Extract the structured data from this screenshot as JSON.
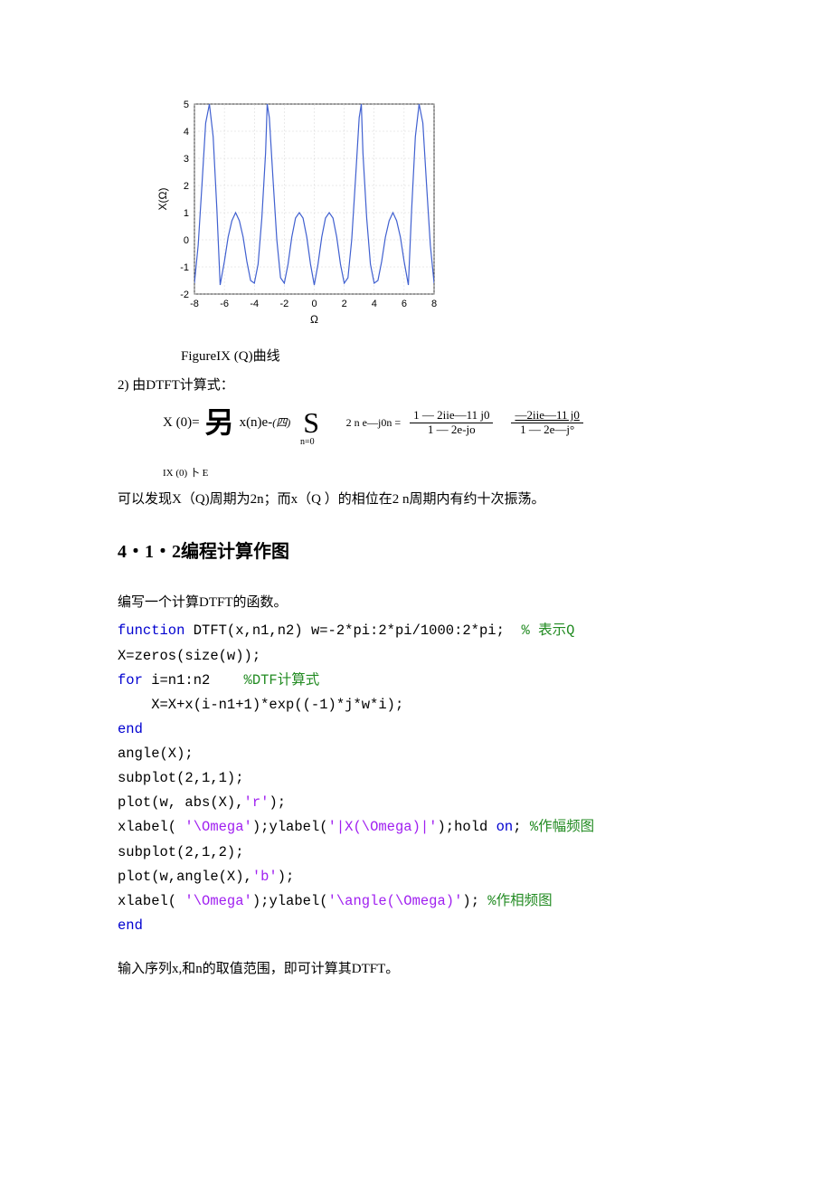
{
  "chart_data": {
    "type": "line",
    "title": "",
    "xlabel": "Ω",
    "ylabel": "X(Ω)",
    "xlim": [
      -8,
      8
    ],
    "ylim": [
      -2,
      5
    ],
    "xticks": [
      -8,
      -6,
      -4,
      -2,
      0,
      2,
      4,
      6,
      8
    ],
    "yticks": [
      -2,
      -1,
      0,
      1,
      2,
      3,
      4,
      5
    ],
    "x": [
      -8.0,
      -7.75,
      -7.5,
      -7.25,
      -7.0,
      -6.75,
      -6.5,
      -6.283,
      -6.0,
      -5.75,
      -5.5,
      -5.25,
      -5.0,
      -4.75,
      -4.5,
      -4.25,
      -4.0,
      -3.75,
      -3.5,
      -3.25,
      -3.142,
      -3.0,
      -2.75,
      -2.5,
      -2.25,
      -2.0,
      -1.75,
      -1.5,
      -1.25,
      -1.0,
      -0.75,
      -0.5,
      -0.25,
      0.0,
      0.25,
      0.5,
      0.75,
      1.0,
      1.25,
      1.5,
      1.75,
      2.0,
      2.25,
      2.5,
      2.75,
      3.0,
      3.142,
      3.25,
      3.5,
      3.75,
      4.0,
      4.25,
      4.5,
      4.75,
      5.0,
      5.25,
      5.5,
      5.75,
      6.0,
      6.283,
      6.5,
      6.75,
      7.0,
      7.25,
      7.5,
      7.75,
      8.0
    ],
    "values": [
      -1.6,
      -0.2,
      2.0,
      4.3,
      5.0,
      3.8,
      1.1,
      -1.667,
      -0.8,
      0.1,
      0.7,
      1.0,
      0.7,
      0.1,
      -0.8,
      -1.5,
      -1.6,
      -0.9,
      0.8,
      3.2,
      5.0,
      4.5,
      2.2,
      0.0,
      -1.4,
      -1.6,
      -0.9,
      0.1,
      0.8,
      1.0,
      0.8,
      0.1,
      -0.9,
      -1.667,
      -0.9,
      0.1,
      0.8,
      1.0,
      0.8,
      0.1,
      -0.9,
      -1.6,
      -1.4,
      0.0,
      2.2,
      4.5,
      5.0,
      3.2,
      0.8,
      -0.9,
      -1.6,
      -1.5,
      -0.8,
      0.1,
      0.7,
      1.0,
      0.7,
      0.1,
      -0.8,
      -1.667,
      1.1,
      3.8,
      5.0,
      4.3,
      2.0,
      -0.2,
      -1.6
    ]
  },
  "fig_caption": "FigureIX (Q)曲线",
  "calc_label": "2) 由DTFT计算式：",
  "eq": {
    "lhs": "X (0)=",
    "cn": "另",
    "term1": "x(n)e-",
    "term1_it": "(四)",
    "S": "S",
    "neq": "n=0",
    "sub2": "2 n e—j0n =",
    "f1num": "1 — 2iie—11 j0",
    "f1den": "1 — 2e-jo",
    "f2num": "—2iie—11 j0",
    "f2den": "1 — 2e—j°"
  },
  "small_eq": "IX (0) 卜 E",
  "obs": "可以发现X（Q)周期为2n；而x（Q ）的相位在2 n周期内有约十次振荡。",
  "heading": "4・1・2编程计算作图",
  "intro": "编写一个计算DTFT的函数。",
  "code": {
    "l1a": "function",
    "l1b": " DTFT(x,n1,n2) w=-2*pi:2*pi/1000:2*pi;  ",
    "l1c": "% 表示Q",
    "l2": "X=zeros(size(w));",
    "l3a": "for",
    "l3b": " i=n1:n2    ",
    "l3c": "%DTF计算式",
    "l4": "    X=X+x(i-n1+1)*exp((-1)*j*w*i);",
    "l5": "end",
    "l6": "angle(X);",
    "l7": "subplot(2,1,1);",
    "l8a": "plot(w, abs(X),",
    "l8b": "'r'",
    "l8c": ");",
    "l9a": "xlabel( ",
    "l9b": "'\\Omega'",
    "l9c": ");ylabel(",
    "l9d": "'|X(\\Omega)|'",
    "l9e": ");hold ",
    "l9f": "on",
    "l9g": "; ",
    "l9h": "%作幅频图",
    "l10": "subplot(2,1,2);",
    "l11a": "plot(w,angle(X),",
    "l11b": "'b'",
    "l11c": ");",
    "l12a": "xlabel( ",
    "l12b": "'\\Omega'",
    "l12c": ");ylabel(",
    "l12d": "'\\angle(\\Omega)'",
    "l12e": "); ",
    "l12f": "%作相频图",
    "l13": "end"
  },
  "post_text": "输入序列x,和n的取值范围，即可计算其DTFT。"
}
